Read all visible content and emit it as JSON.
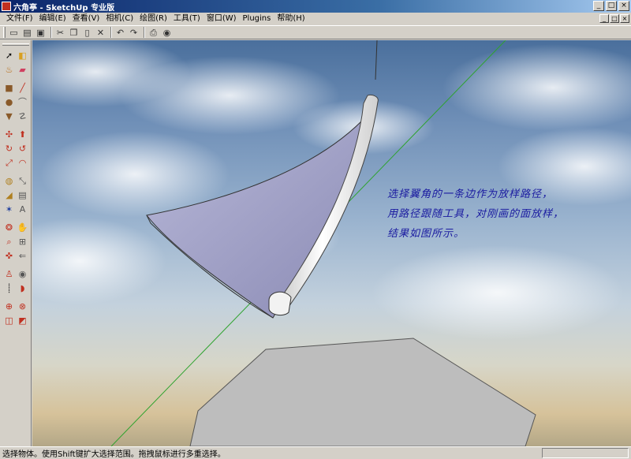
{
  "window": {
    "title": "六角亭 - SketchUp 专业版",
    "controls": {
      "minimize": "_",
      "maximize": "□",
      "close": "×"
    }
  },
  "menu": {
    "items": [
      "文件(F)",
      "编辑(E)",
      "查看(V)",
      "相机(C)",
      "绘图(R)",
      "工具(T)",
      "窗口(W)",
      "Plugins",
      "帮助(H)"
    ]
  },
  "toolbar": {
    "buttons": [
      {
        "name": "new-icon",
        "glyph": "▭"
      },
      {
        "name": "open-icon",
        "glyph": "▤"
      },
      {
        "name": "save-icon",
        "glyph": "▣"
      },
      {
        "name": "cut-icon",
        "glyph": "✂"
      },
      {
        "name": "copy-icon",
        "glyph": "❐"
      },
      {
        "name": "paste-icon",
        "glyph": "▯"
      },
      {
        "name": "erase-icon",
        "glyph": "✕"
      },
      {
        "name": "undo-icon",
        "glyph": "↶"
      },
      {
        "name": "redo-icon",
        "glyph": "↷"
      },
      {
        "name": "print-icon",
        "glyph": "⎙"
      },
      {
        "name": "model-info-icon",
        "glyph": "◉"
      }
    ]
  },
  "annotation": {
    "lines": [
      "选择翼角的一条边作为放样路径，",
      "用路径跟随工具，对刚画的面放样，",
      "结果如图所示。"
    ],
    "color": "#1a1aa0"
  },
  "status": {
    "text": "选择物体。使用Shift键扩大选择范围。拖拽鼠标进行多重选择。"
  },
  "colors": {
    "titlebar_start": "#0a246a",
    "titlebar_end": "#a6caf0",
    "chrome": "#d4d0c8",
    "face_front": "#9c9cc4",
    "face_grey": "#bdbdbd",
    "green_axis": "#2fa32f"
  }
}
